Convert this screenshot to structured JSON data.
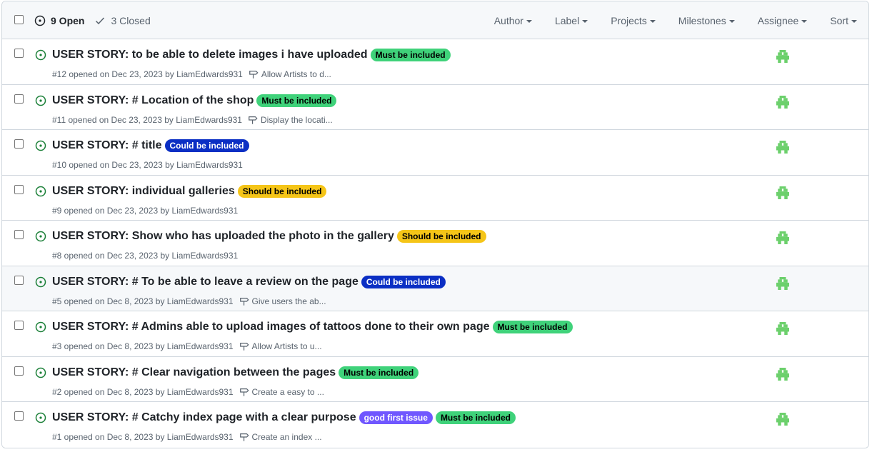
{
  "header": {
    "open_label": "9 Open",
    "closed_label": "3 Closed",
    "filters": [
      "Author",
      "Label",
      "Projects",
      "Milestones",
      "Assignee",
      "Sort"
    ]
  },
  "issues": [
    {
      "title": "USER STORY: to be able to delete images i have uploaded",
      "labels": [
        {
          "name": "Must be included",
          "bg": "#3fd27a",
          "fg": "#000000"
        }
      ],
      "meta": "#12 opened on Dec 23, 2023 by LiamEdwards931",
      "milestone": "Allow Artists to d..."
    },
    {
      "title": "USER STORY: # Location of the shop",
      "labels": [
        {
          "name": "Must be included",
          "bg": "#3fd27a",
          "fg": "#000000"
        }
      ],
      "meta": "#11 opened on Dec 23, 2023 by LiamEdwards931",
      "milestone": "Display the locati..."
    },
    {
      "title": "USER STORY: # title",
      "labels": [
        {
          "name": "Could be included",
          "bg": "#0b2fc4",
          "fg": "#ffffff"
        }
      ],
      "meta": "#10 opened on Dec 23, 2023 by LiamEdwards931",
      "milestone": ""
    },
    {
      "title": "USER STORY: individual galleries",
      "labels": [
        {
          "name": "Should be included",
          "bg": "#f5c518",
          "fg": "#000000"
        }
      ],
      "meta": "#9 opened on Dec 23, 2023 by LiamEdwards931",
      "milestone": ""
    },
    {
      "title": "USER STORY: Show who has uploaded the photo in the gallery",
      "labels": [
        {
          "name": "Should be included",
          "bg": "#f5c518",
          "fg": "#000000"
        }
      ],
      "meta": "#8 opened on Dec 23, 2023 by LiamEdwards931",
      "milestone": ""
    },
    {
      "title": "USER STORY: # To be able to leave a review on the page",
      "labels": [
        {
          "name": "Could be included",
          "bg": "#0b2fc4",
          "fg": "#ffffff"
        }
      ],
      "meta": "#5 opened on Dec 8, 2023 by LiamEdwards931",
      "milestone": "Give users the ab...",
      "hover": true
    },
    {
      "title": "USER STORY: # Admins able to upload images of tattoos done to their own page",
      "labels": [
        {
          "name": "Must be included",
          "bg": "#3fd27a",
          "fg": "#000000"
        }
      ],
      "meta": "#3 opened on Dec 8, 2023 by LiamEdwards931",
      "milestone": "Allow Artists to u..."
    },
    {
      "title": "USER STORY: # Clear navigation between the pages",
      "labels": [
        {
          "name": "Must be included",
          "bg": "#3fd27a",
          "fg": "#000000"
        }
      ],
      "meta": "#2 opened on Dec 8, 2023 by LiamEdwards931",
      "milestone": "Create a easy to ..."
    },
    {
      "title": "USER STORY: # Catchy index page with a clear purpose",
      "labels": [
        {
          "name": "good first issue",
          "bg": "#7057ff",
          "fg": "#ffffff"
        },
        {
          "name": "Must be included",
          "bg": "#3fd27a",
          "fg": "#000000"
        }
      ],
      "meta": "#1 opened on Dec 8, 2023 by LiamEdwards931",
      "milestone": "Create an index ..."
    }
  ],
  "colors": {
    "open_icon": "#1a7f37",
    "avatar": "#6cd06c",
    "muted": "#59636e"
  }
}
